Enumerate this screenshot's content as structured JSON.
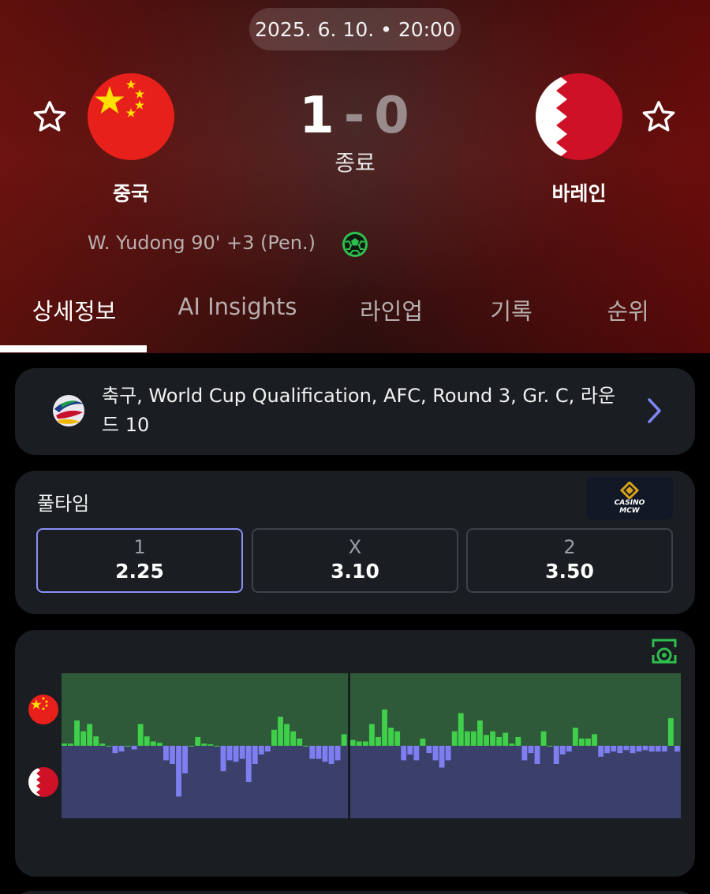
{
  "match": {
    "datetime": "2025. 6. 10. • 20:00",
    "home": {
      "name": "중국",
      "score": "1",
      "flag": "china-flag"
    },
    "away": {
      "name": "바레인",
      "score": "0",
      "flag": "bahrain-flag"
    },
    "separator": "-",
    "status": "종료",
    "goals": [
      {
        "text": "W. Yudong 90' +3 (Pen.)",
        "icon": "soccer-ball-icon",
        "color": "#2fbf4d"
      }
    ]
  },
  "tabs": [
    {
      "label": "상세정보",
      "active": true
    },
    {
      "label": "AI Insights",
      "active": false
    },
    {
      "label": "라인업",
      "active": false
    },
    {
      "label": "기록",
      "active": false
    },
    {
      "label": "순위",
      "active": false
    }
  ],
  "competition": {
    "text": "축구, World Cup Qualification, AFC, Round 3, Gr. C, 라운드 10",
    "icon": "afc-logo-icon",
    "accent": "#7f86f5"
  },
  "odds": {
    "title": "풀타임",
    "sponsor": {
      "line1": "CASINO",
      "line2": "MCW"
    },
    "options": [
      {
        "label": "1",
        "value": "2.25",
        "selected": true
      },
      {
        "label": "X",
        "value": "3.10",
        "selected": false
      },
      {
        "label": "2",
        "value": "3.50",
        "selected": false
      }
    ],
    "selected_border": "#8c8ff4"
  },
  "momentum": {
    "icon": "pitch-ball-icon",
    "home_color": "#3fcf4a",
    "away_color": "#7e7ef0",
    "home_bg": "#2f5a3a",
    "away_bg": "#3a406a",
    "half_split_index": 45,
    "values": [
      0.03,
      0.03,
      0.35,
      0.2,
      0.3,
      0.13,
      0.03,
      0,
      -0.1,
      -0.08,
      0,
      -0.05,
      0.3,
      0.13,
      0.06,
      0.04,
      -0.2,
      -0.25,
      -0.7,
      -0.38,
      0,
      0.12,
      0.03,
      0.02,
      0,
      -0.35,
      -0.2,
      -0.22,
      -0.18,
      -0.5,
      -0.25,
      -0.12,
      -0.08,
      0.22,
      0.4,
      0.3,
      0.2,
      0.1,
      0,
      -0.18,
      -0.18,
      -0.22,
      -0.25,
      -0.2,
      0.16,
      0.08,
      0.06,
      0.06,
      0.3,
      0.12,
      0.5,
      0.25,
      0.2,
      -0.2,
      -0.12,
      -0.2,
      0.1,
      -0.1,
      -0.2,
      -0.3,
      -0.2,
      0.2,
      0.45,
      0.2,
      0.2,
      0.35,
      0.15,
      0.2,
      0.12,
      0.18,
      0.03,
      0.12,
      -0.2,
      -0.1,
      -0.25,
      0.2,
      0,
      -0.25,
      -0.12,
      -0.08,
      0.25,
      0.1,
      0.1,
      0.16,
      -0.15,
      -0.1,
      -0.08,
      -0.1,
      -0.06,
      -0.1,
      -0.08,
      -0.06,
      -0.08,
      -0.08,
      -0.08,
      0.38,
      -0.08
    ]
  }
}
